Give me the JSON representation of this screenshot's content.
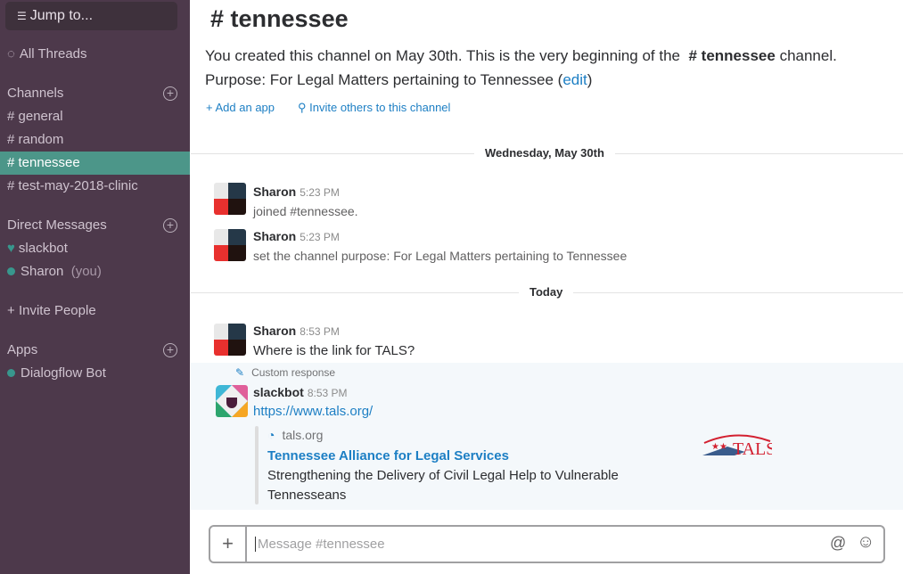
{
  "sidebar": {
    "jump": "Jump to...",
    "all_threads": "All Threads",
    "channels_header": "Channels",
    "channels": [
      "general",
      "random",
      "tennessee",
      "test-may-2018-clinic"
    ],
    "dm_header": "Direct Messages",
    "dms": [
      {
        "name": "slackbot",
        "note": ""
      },
      {
        "name": "Sharon",
        "note": "(you)"
      }
    ],
    "invite": "Invite People",
    "apps_header": "Apps",
    "apps": [
      "Dialogflow Bot"
    ],
    "active_color": "#4c9689",
    "bg_color": "#4d394b"
  },
  "channel": {
    "title": "tennessee",
    "intro_pre": "You created this channel on May 30th. This is the very beginning of the",
    "intro_channel": "tennessee",
    "intro_post": "channel.",
    "purpose": "Purpose: For Legal Matters pertaining to Tennessee",
    "edit": "edit",
    "add_app": "Add an app",
    "invite": "Invite others to this channel"
  },
  "dividers": [
    "Wednesday, May 30th",
    "Today"
  ],
  "messages": [
    {
      "user": "Sharon",
      "time": "5:23 PM",
      "text": "joined #tennessee."
    },
    {
      "user": "Sharon",
      "time": "5:23 PM",
      "text": "set the channel purpose: For Legal Matters pertaining to Tennessee"
    },
    {
      "user": "Sharon",
      "time": "8:53 PM",
      "text": "Where is the link for TALS?"
    },
    {
      "custom": "Custom response",
      "user": "slackbot",
      "time": "8:53 PM",
      "text": "https://www.tals.org/",
      "unfurl": {
        "site": "tals.org",
        "title": "Tennessee Alliance for Legal Services",
        "desc1": "Strengthening the Delivery of Civil Legal Help to Vulnerable",
        "desc2": "Tennesseans",
        "logo": "TALS"
      }
    }
  ],
  "composer": {
    "placeholder": "Message #tennessee"
  }
}
